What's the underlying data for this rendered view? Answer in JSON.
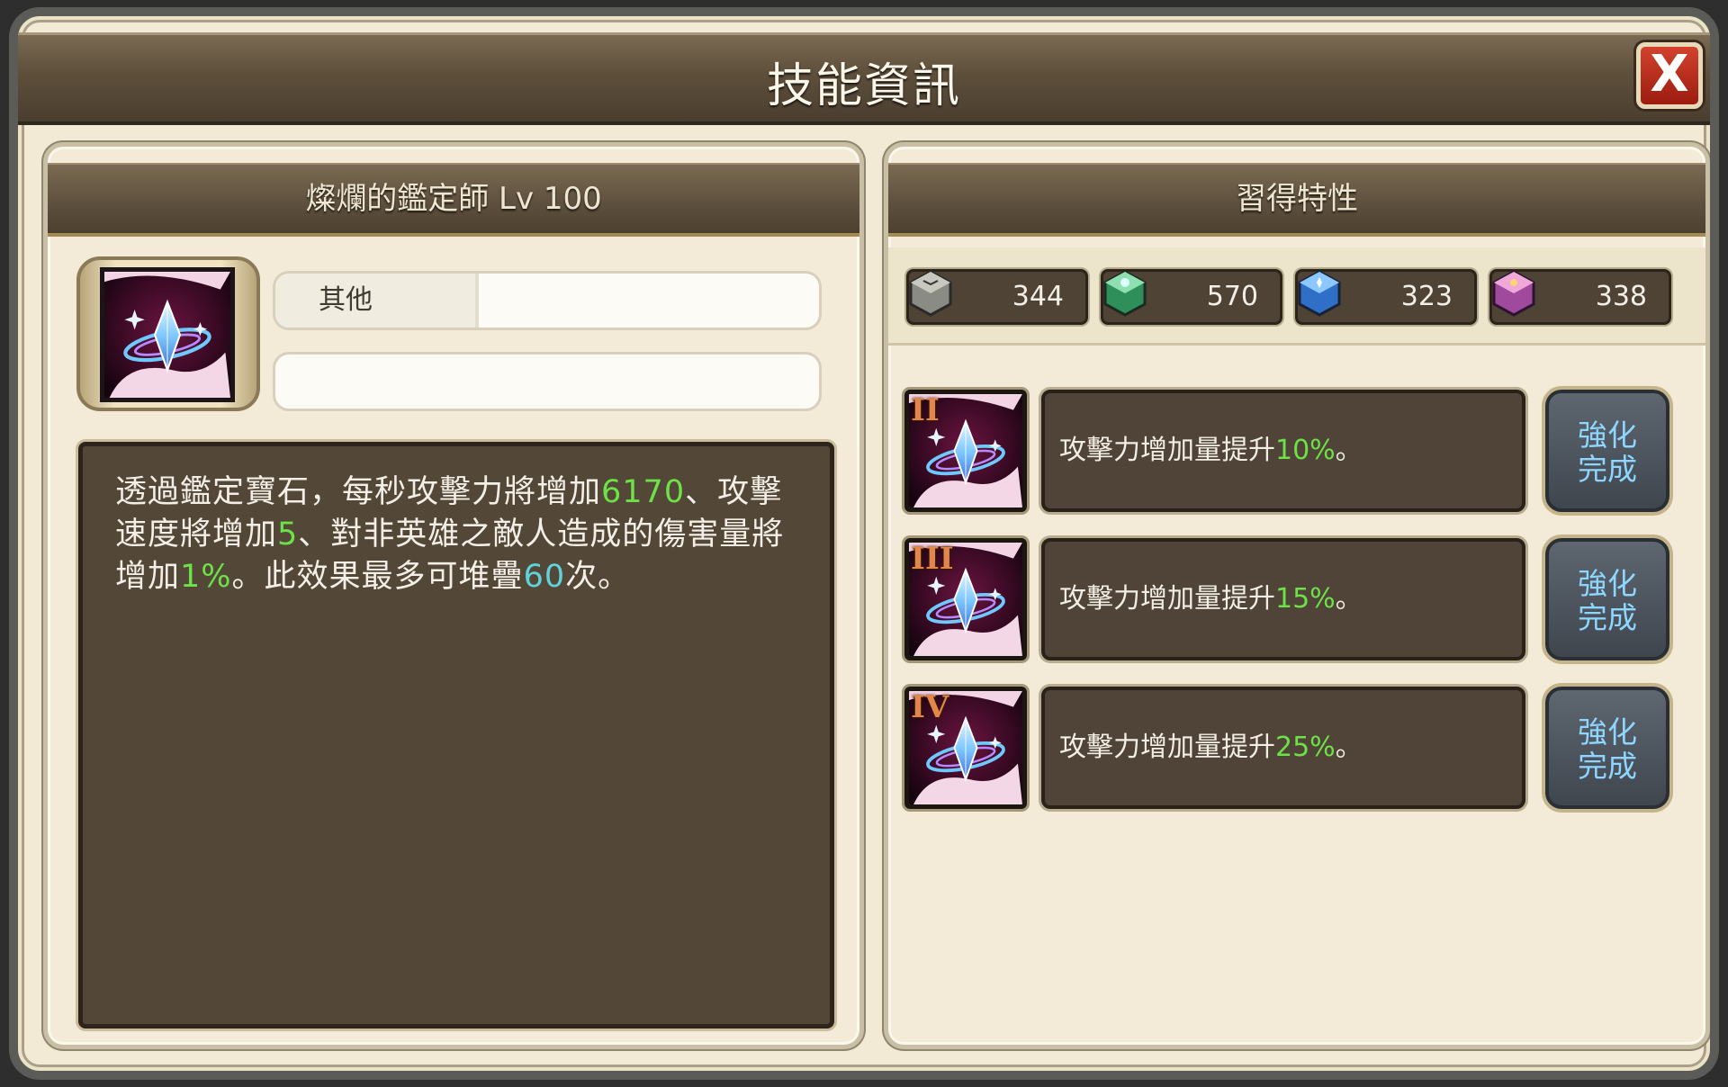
{
  "window": {
    "title": "技能資訊",
    "close_label": "X"
  },
  "skill": {
    "name_level": "燦爛的鑑定師 Lv  100",
    "category": "其他",
    "secondary_value": "",
    "icon": "gem-hand-icon",
    "description": {
      "p1": "透過鑑定寶石，每秒攻擊力將增加",
      "v1": "6170",
      "p2": "、攻擊速度將增加",
      "v2": "5",
      "p3": "、對非英雄之敵人造成的傷害量將增加",
      "v3": "1%",
      "p4": "。此效果最多可堆疊",
      "v4": "60",
      "p5": "次。"
    }
  },
  "traits_panel": {
    "title": "習得特性",
    "resources": [
      {
        "icon": "gray-cube-icon",
        "value": "344"
      },
      {
        "icon": "green-cube-icon",
        "value": "570"
      },
      {
        "icon": "blue-cube-icon",
        "value": "323"
      },
      {
        "icon": "purple-cube-icon",
        "value": "338"
      }
    ],
    "traits": [
      {
        "tier": "II",
        "text": "攻擊力增加量提升",
        "value": "10%",
        "suffix": "。",
        "button_line1": "強化",
        "button_line2": "完成"
      },
      {
        "tier": "III",
        "text": "攻擊力增加量提升",
        "value": "15%",
        "suffix": "。",
        "button_line1": "強化",
        "button_line2": "完成"
      },
      {
        "tier": "IV",
        "text": "攻擊力增加量提升",
        "value": "25%",
        "suffix": "。",
        "button_line1": "強化",
        "button_line2": "完成"
      }
    ]
  },
  "colors": {
    "highlight_green": "#6ee048",
    "highlight_cyan": "#5fd3dc",
    "button_text": "#8fd6ff"
  }
}
